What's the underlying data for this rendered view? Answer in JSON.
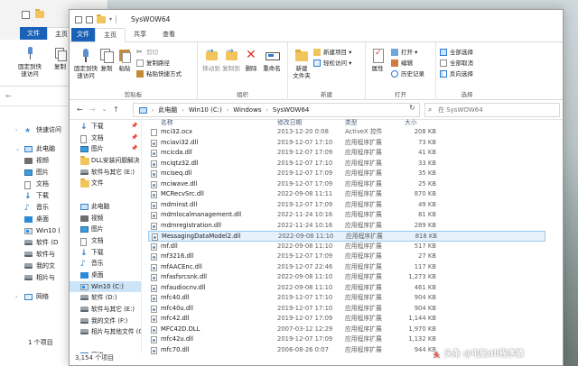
{
  "bg_window": {
    "tab_file": "文件",
    "tab_home": "主页",
    "pin_label_1": "固定到快",
    "pin_label_2": "速访问",
    "copy_label": "复制",
    "status": "1 个项目",
    "nav": [
      {
        "label": "快速访问",
        "icon": "star-icon"
      },
      {
        "label": "此电脑",
        "icon": "pc-icon"
      },
      {
        "label": "视频",
        "icon": "video-icon"
      },
      {
        "label": "图片",
        "icon": "picture-icon"
      },
      {
        "label": "文档",
        "icon": "document-icon"
      },
      {
        "label": "下载",
        "icon": "download-icon"
      },
      {
        "label": "音乐",
        "icon": "music-icon"
      },
      {
        "label": "桌面",
        "icon": "desktop-icon"
      },
      {
        "label": "Win10 (",
        "icon": "drive-icon"
      },
      {
        "label": "软件 (D",
        "icon": "drive-icon"
      },
      {
        "label": "软件与",
        "icon": "drive-icon"
      },
      {
        "label": "我的文",
        "icon": "drive-icon"
      },
      {
        "label": "相片与",
        "icon": "drive-icon"
      },
      {
        "label": "网络",
        "icon": "network-icon"
      }
    ]
  },
  "window": {
    "title": "SysWOW64",
    "tabs": {
      "file": "文件",
      "home": "主页",
      "share": "共享",
      "view": "查看"
    },
    "ribbon": {
      "clipboard": {
        "pin_1": "固定到快",
        "pin_2": "速访问",
        "copy": "复制",
        "paste": "粘贴",
        "cut": "剪切",
        "copy_path": "复制路径",
        "paste_shortcut": "粘贴快捷方式",
        "label": "剪贴板"
      },
      "organize": {
        "move_to": "移动到",
        "copy_to": "复制到",
        "delete": "删除",
        "rename": "重命名",
        "label": "组织"
      },
      "new": {
        "new_folder_1": "新建",
        "new_folder_2": "文件夹",
        "new_item": "新建项目 ▾",
        "easy_access": "轻松访问 ▾",
        "label": "新建"
      },
      "open": {
        "properties": "属性",
        "open": "打开 ▾",
        "edit": "编辑",
        "history": "历史记录",
        "label": "打开"
      },
      "select": {
        "select_all": "全部选择",
        "select_none": "全部取消",
        "invert": "反向选择",
        "label": "选择"
      }
    },
    "address": {
      "crumbs": [
        "此电脑",
        "Win10 (C:)",
        "Windows",
        "SysWOW64"
      ],
      "search_placeholder": "在 SysWOW64"
    },
    "nav": [
      {
        "label": "下载",
        "icon": "download-icon",
        "pinned": true
      },
      {
        "label": "文档",
        "icon": "document-icon",
        "pinned": true
      },
      {
        "label": "图片",
        "icon": "picture-icon",
        "pinned": true
      },
      {
        "label": "DLL安装问题解决",
        "icon": "folder-icon",
        "pinned": false
      },
      {
        "label": "软件与其它 (E:)",
        "icon": "drive-icon",
        "pinned": false
      },
      {
        "label": "文件",
        "icon": "folder-icon",
        "pinned": false
      },
      {
        "label": "",
        "icon": "",
        "pinned": false
      },
      {
        "label": "此电脑",
        "icon": "pc-icon",
        "pinned": false
      },
      {
        "label": "视频",
        "icon": "video-icon",
        "pinned": false
      },
      {
        "label": "图片",
        "icon": "picture-icon",
        "pinned": false
      },
      {
        "label": "文档",
        "icon": "document-icon",
        "pinned": false
      },
      {
        "label": "下载",
        "icon": "download-icon",
        "pinned": false
      },
      {
        "label": "音乐",
        "icon": "music-icon",
        "pinned": false
      },
      {
        "label": "桌面",
        "icon": "desktop-icon",
        "pinned": false
      },
      {
        "label": "Win10 (C:)",
        "icon": "drive-icon",
        "pinned": false,
        "selected": true
      },
      {
        "label": "软件 (D:)",
        "icon": "drive-icon",
        "pinned": false
      },
      {
        "label": "软件与其它 (E:)",
        "icon": "drive-icon",
        "pinned": false
      },
      {
        "label": "我的文件 (F:)",
        "icon": "drive-icon",
        "pinned": false
      },
      {
        "label": "相片与其他文件 (G",
        "icon": "drive-icon",
        "pinned": false
      },
      {
        "label": "",
        "icon": "",
        "pinned": false
      },
      {
        "label": "网络",
        "icon": "network-icon",
        "pinned": false
      }
    ],
    "columns": {
      "name": "名称",
      "date": "修改日期",
      "type": "类型",
      "size": "大小"
    },
    "files": [
      {
        "name": "mci32.ocx",
        "date": "2013-12-20 0:08",
        "type": "ActiveX 控件",
        "size": "208 KB"
      },
      {
        "name": "mciavi32.dll",
        "date": "2019-12-07 17:10",
        "type": "应用程序扩展",
        "size": "73 KB"
      },
      {
        "name": "mcicda.dll",
        "date": "2019-12-07 17:09",
        "type": "应用程序扩展",
        "size": "41 KB"
      },
      {
        "name": "mciqtz32.dll",
        "date": "2019-12-07 17:10",
        "type": "应用程序扩展",
        "size": "33 KB"
      },
      {
        "name": "mciseq.dll",
        "date": "2019-12-07 17:09",
        "type": "应用程序扩展",
        "size": "35 KB"
      },
      {
        "name": "mciwave.dll",
        "date": "2019-12-07 17:09",
        "type": "应用程序扩展",
        "size": "25 KB"
      },
      {
        "name": "MCRecvSrc.dll",
        "date": "2022-09-08 11:11",
        "type": "应用程序扩展",
        "size": "870 KB"
      },
      {
        "name": "mdminst.dll",
        "date": "2019-12-07 17:09",
        "type": "应用程序扩展",
        "size": "49 KB"
      },
      {
        "name": "mdmlocalmanagement.dll",
        "date": "2022-11-24 10:16",
        "type": "应用程序扩展",
        "size": "81 KB"
      },
      {
        "name": "mdmregistration.dll",
        "date": "2022-11-24 10:16",
        "type": "应用程序扩展",
        "size": "289 KB"
      },
      {
        "name": "MessagingDataModel2.dll",
        "date": "2022-09-08 11:10",
        "type": "应用程序扩展",
        "size": "818 KB",
        "selected": true
      },
      {
        "name": "mf.dll",
        "date": "2022-09-08 11:10",
        "type": "应用程序扩展",
        "size": "517 KB"
      },
      {
        "name": "mf3216.dll",
        "date": "2019-12-07 17:09",
        "type": "应用程序扩展",
        "size": "27 KB"
      },
      {
        "name": "mfAACEnc.dll",
        "date": "2019-12-07 22:46",
        "type": "应用程序扩展",
        "size": "117 KB"
      },
      {
        "name": "mfasfsrcsnk.dll",
        "date": "2022-09-08 11:10",
        "type": "应用程序扩展",
        "size": "1,273 KB"
      },
      {
        "name": "mfaudiocnv.dll",
        "date": "2022-09-08 11:10",
        "type": "应用程序扩展",
        "size": "461 KB"
      },
      {
        "name": "mfc40.dll",
        "date": "2019-12-07 17:10",
        "type": "应用程序扩展",
        "size": "904 KB"
      },
      {
        "name": "mfc40u.dll",
        "date": "2019-12-07 17:10",
        "type": "应用程序扩展",
        "size": "904 KB"
      },
      {
        "name": "mfc42.dll",
        "date": "2019-12-07 17:09",
        "type": "应用程序扩展",
        "size": "1,144 KB"
      },
      {
        "name": "MFC42D.DLL",
        "date": "2007-03-12 12:29",
        "type": "应用程序扩展",
        "size": "1,970 KB"
      },
      {
        "name": "mfc42u.dll",
        "date": "2019-12-07 17:09",
        "type": "应用程序扩展",
        "size": "1,132 KB"
      },
      {
        "name": "mfc70.dll",
        "date": "2006-08-26 0:07",
        "type": "应用程序扩展",
        "size": "944 KB"
      }
    ],
    "status": "3,154 个项目"
  },
  "watermark": {
    "logo": "头",
    "text": "头条 @电脑dll程序猿"
  },
  "colors": {
    "accent": "#1a62b8",
    "selection": "#cce4f7",
    "folder": "#f2c55c"
  }
}
